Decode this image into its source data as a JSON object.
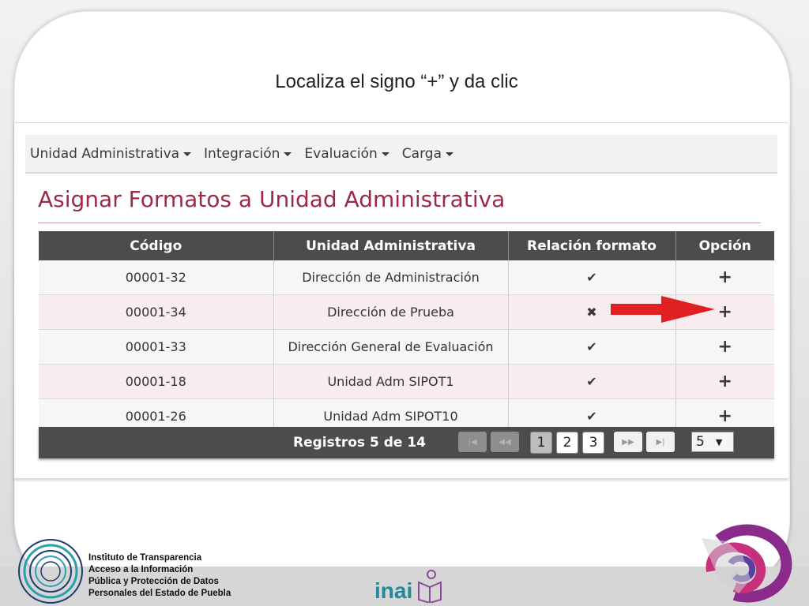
{
  "slide": {
    "instruction": "Localiza el signo “+” y da clic"
  },
  "nav": {
    "items": [
      {
        "label": "Unidad Administrativa"
      },
      {
        "label": "Integración"
      },
      {
        "label": "Evaluación"
      },
      {
        "label": "Carga"
      }
    ]
  },
  "page": {
    "title": "Asignar Formatos a Unidad Administrativa"
  },
  "table": {
    "headers": {
      "code": "Código",
      "unit": "Unidad Administrativa",
      "relation": "Relación formato",
      "option": "Opción"
    },
    "rows": [
      {
        "code": "00001-32",
        "unit": "Dirección de Administración",
        "relation": "✔",
        "relation_icon": "check-icon",
        "option": "+"
      },
      {
        "code": "00001-34",
        "unit": "Dirección de Prueba",
        "relation": "✖",
        "relation_icon": "cross-icon",
        "option": "+"
      },
      {
        "code": "00001-33",
        "unit": "Dirección General de Evaluación",
        "relation": "✔",
        "relation_icon": "check-icon",
        "option": "+"
      },
      {
        "code": "00001-18",
        "unit": "Unidad Adm SIPOT1",
        "relation": "✔",
        "relation_icon": "check-icon",
        "option": "+"
      },
      {
        "code": "00001-26",
        "unit": "Unidad Adm SIPOT10",
        "relation": "✔",
        "relation_icon": "check-icon",
        "option": "+"
      }
    ]
  },
  "pager": {
    "records": "Registros 5 de 14",
    "first": "|◀",
    "prev": "◀◀",
    "pages": [
      "1",
      "2",
      "3"
    ],
    "next": "▶▶",
    "last": "▶|",
    "page_size": "5",
    "page_size_caret": "▼"
  },
  "footer": {
    "institute_lines": [
      "Instituto de Transparencia",
      "Acceso a la Información",
      "Pública y Protección de Datos",
      "Personales del Estado de Puebla"
    ],
    "inai": "inai"
  },
  "colors": {
    "title": "#9c2a45",
    "header_bg": "#4d4c4c",
    "arrow": "#e02020"
  }
}
